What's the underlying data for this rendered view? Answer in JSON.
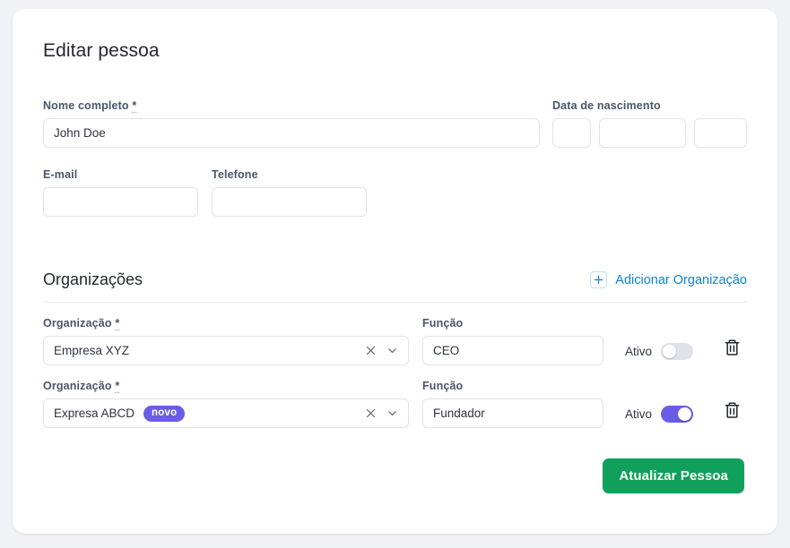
{
  "page": {
    "title": "Editar pessoa",
    "background_color": "#f0f2f5",
    "card_color": "#ffffff"
  },
  "form": {
    "name": {
      "label": "Nome completo",
      "required_mark": "*",
      "value": "John Doe",
      "placeholder": ""
    },
    "birthdate": {
      "label": "Data de nascimento",
      "day": {
        "value": "",
        "placeholder": ""
      },
      "month": {
        "value": "",
        "placeholder": ""
      },
      "year": {
        "value": "",
        "placeholder": ""
      }
    },
    "email": {
      "label": "E-mail",
      "value": "",
      "placeholder": ""
    },
    "phone": {
      "label": "Telefone",
      "value": "",
      "placeholder": ""
    }
  },
  "organizations_section": {
    "title": "Organizações",
    "add_link": "Adicionar Organização",
    "add_icon": "plus-icon",
    "accent_color": "#0a84d8",
    "org_label": "Organização",
    "org_required_mark": "*",
    "role_label": "Função",
    "active_label": "Ativo",
    "clear_icon": "close-icon",
    "dropdown_icon": "chevron-down-icon",
    "delete_icon": "trash-icon",
    "toggle_on_color": "#6b5ce7",
    "toggle_off_color": "#dfe2e8",
    "rows": [
      {
        "organization": "Empresa XYZ",
        "badge": "",
        "role": "CEO",
        "active": false,
        "active_state_text": "off"
      },
      {
        "organization": "Expresa ABCD",
        "badge": "novo",
        "role": "Fundador",
        "active": true,
        "active_state_text": "on"
      }
    ]
  },
  "submit": {
    "label": "Atualizar Pessoa",
    "color": "#10a05c"
  }
}
